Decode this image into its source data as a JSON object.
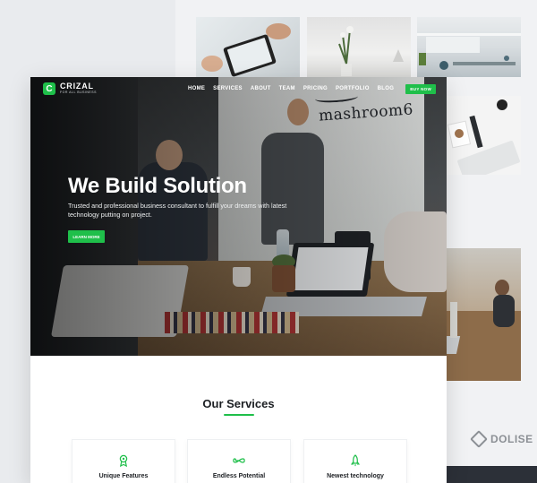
{
  "brand": {
    "name": "CRIZAL",
    "tagline": "FOR ALL BUSINESS",
    "badge": "C"
  },
  "nav": {
    "items": [
      "HOME",
      "SERVICES",
      "ABOUT",
      "TEAM",
      "PRICING",
      "PORTFOLIO",
      "BLOG"
    ],
    "cta": "BUY NOW"
  },
  "hero": {
    "title": "We Build Solution",
    "subtitle": "Trusted and professional business consultant to fulfill your dreams with latest technology putting on project.",
    "button": "LEARN MORE",
    "wall_sign": "mashroom6"
  },
  "services": {
    "title": "Our Services",
    "features": [
      {
        "label": "Unique Features",
        "icon": "award-icon"
      },
      {
        "label": "Endless Potential",
        "icon": "infinity-icon"
      },
      {
        "label": "Newest technology",
        "icon": "rocket-icon"
      }
    ]
  },
  "background": {
    "partner_logo": "DOLISE",
    "partial_logo": "S"
  },
  "colors": {
    "accent": "#1fbf4a",
    "dark": "#1c1f23"
  }
}
